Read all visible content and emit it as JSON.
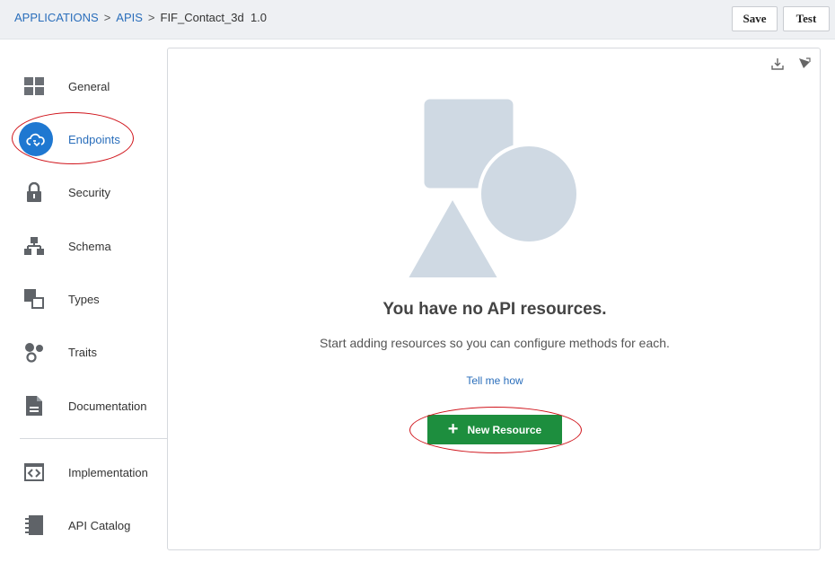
{
  "breadcrumb": {
    "applications": "APPLICATIONS",
    "sep1": ">",
    "apis": "APIS",
    "sep2": ">",
    "current": "FIF_Contact_3d  1.0"
  },
  "toolbar": {
    "save_label": "Save",
    "test_label": "Test"
  },
  "sidebar": {
    "items": [
      {
        "label": "General",
        "icon": "grid-icon"
      },
      {
        "label": "Endpoints",
        "icon": "cloud-endpoint-icon",
        "active": true
      },
      {
        "label": "Security",
        "icon": "lock-icon"
      },
      {
        "label": "Schema",
        "icon": "hierarchy-icon"
      },
      {
        "label": "Types",
        "icon": "types-icon"
      },
      {
        "label": "Traits",
        "icon": "traits-icon"
      },
      {
        "label": "Documentation",
        "icon": "document-icon"
      },
      {
        "label": "Implementation",
        "icon": "code-icon"
      },
      {
        "label": "API Catalog",
        "icon": "catalog-icon"
      }
    ]
  },
  "main": {
    "empty_title": "You have no API resources.",
    "empty_desc": "Start adding resources so you can configure methods for each.",
    "help_link": "Tell me how",
    "new_resource_label": "New Resource",
    "new_resource_icon": "+"
  },
  "colors": {
    "accent": "#1f78d1",
    "link": "#2a6ebb",
    "primary_button": "#1d8e3e",
    "highlight": "#d0141b",
    "illustration": "#cfd9e3"
  }
}
